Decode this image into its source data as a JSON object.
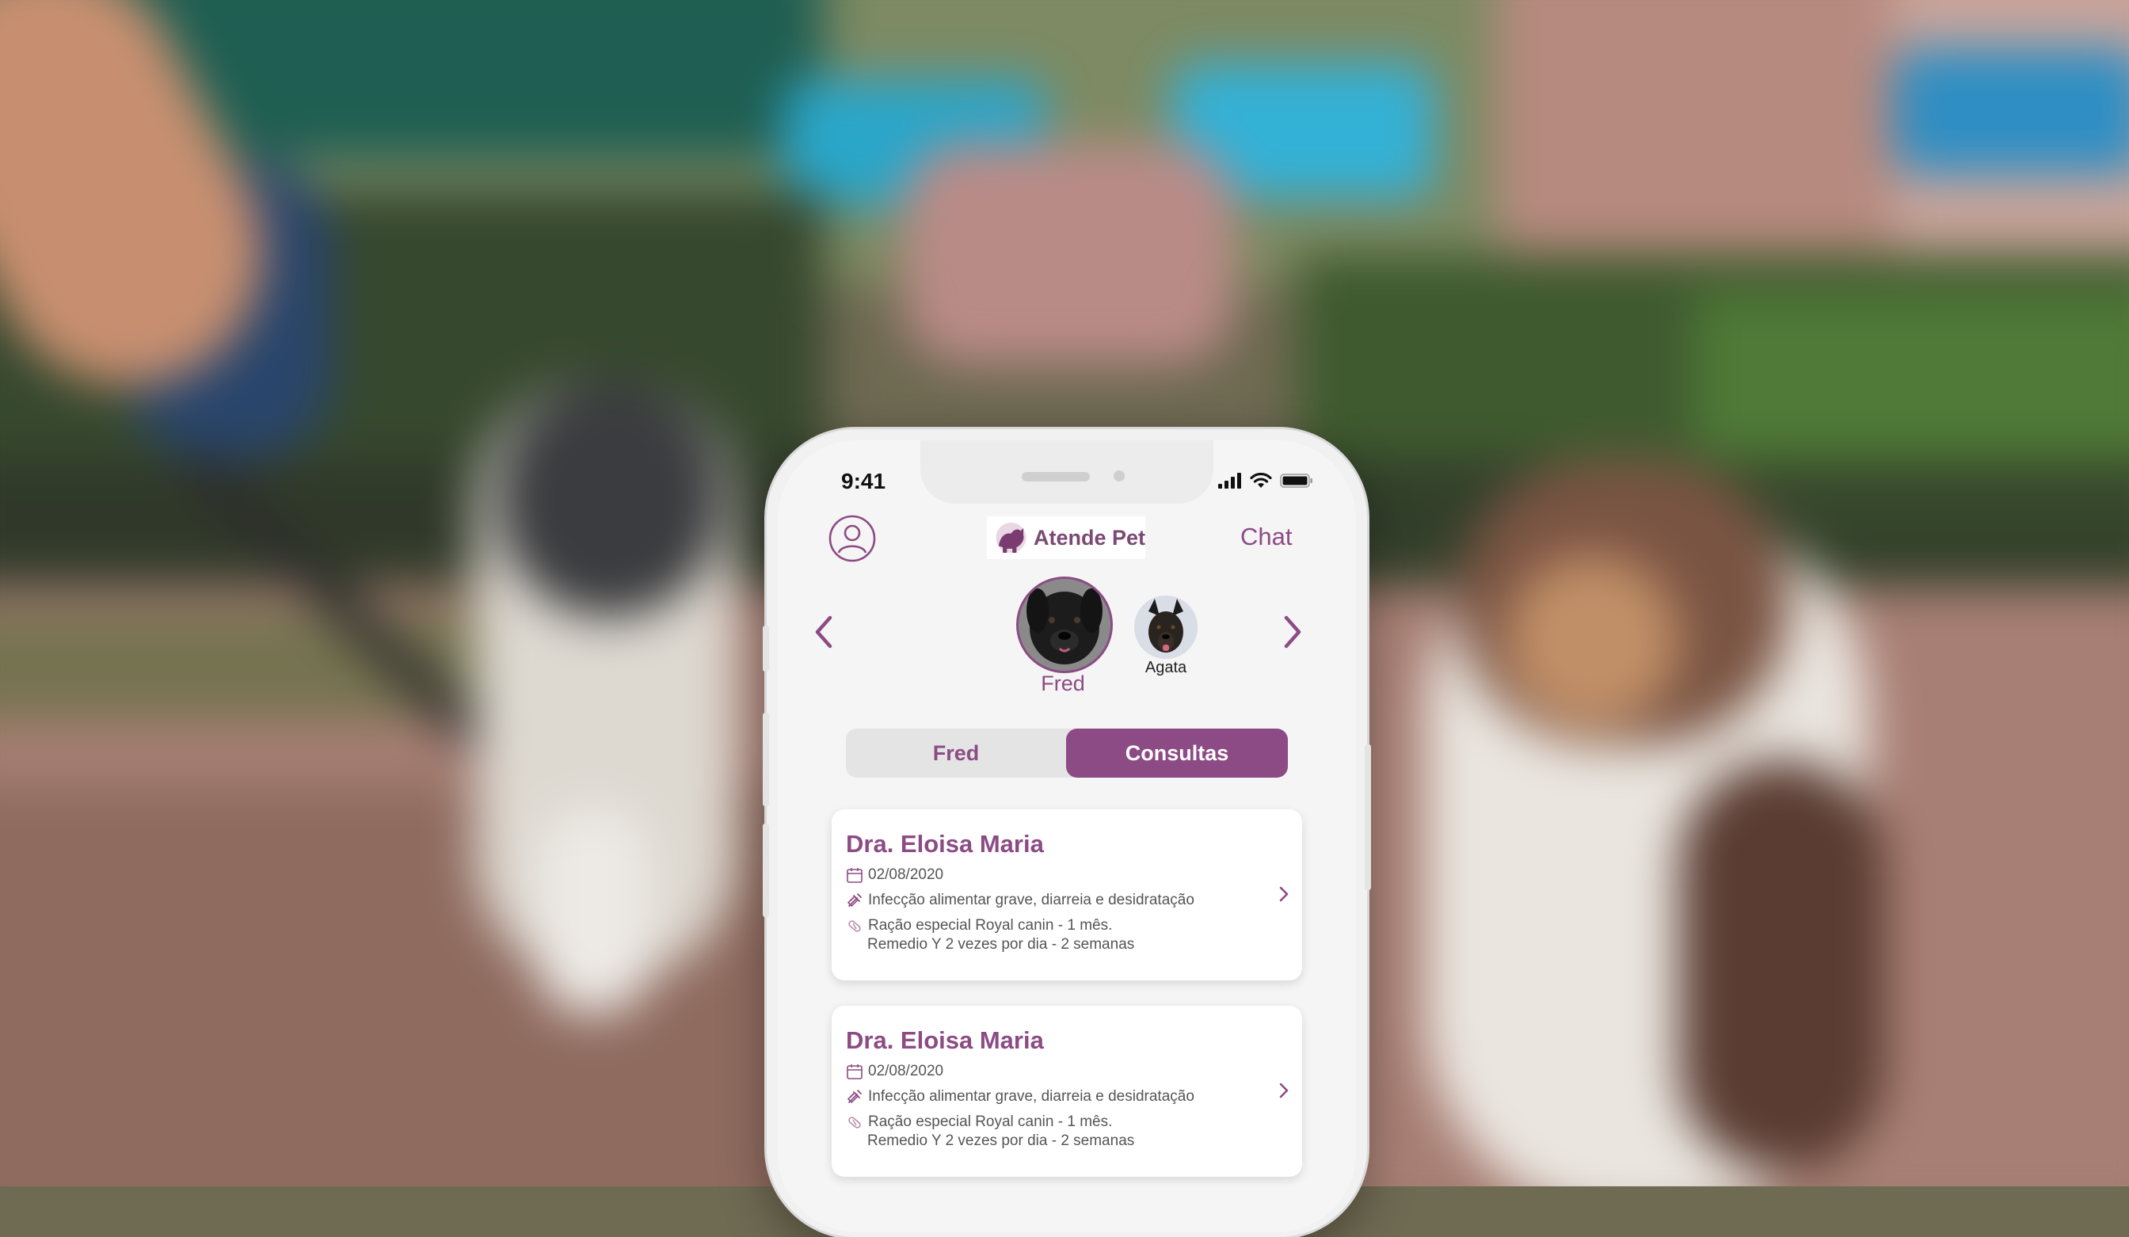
{
  "status_bar": {
    "time": "9:41"
  },
  "header": {
    "logo_text": "Atende Pet",
    "chat_label": "Chat",
    "profile_icon": "user-circle-icon"
  },
  "pets": {
    "selected": {
      "name": "Fred"
    },
    "next": {
      "name": "Agata"
    }
  },
  "tabs": [
    {
      "label": "Fred",
      "active": false
    },
    {
      "label": "Consultas",
      "active": true
    }
  ],
  "consultations": [
    {
      "vet": "Dra. Eloisa Maria",
      "date": "02/08/2020",
      "diagnosis": "Infecção alimentar grave, diarreia e desidratação",
      "treatment_line1": "Ração especial Royal canin - 1 mês.",
      "treatment_line2": "Remedio Y 2 vezes por dia - 2 semanas"
    },
    {
      "vet": "Dra. Eloisa Maria",
      "date": "02/08/2020",
      "diagnosis": "Infecção alimentar grave, diarreia e desidratação",
      "treatment_line1": "Ração especial Royal canin - 1 mês.",
      "treatment_line2": "Remedio Y 2 vezes por dia - 2 semanas"
    }
  ],
  "colors": {
    "accent": "#8c4b84",
    "tab_bg": "#e4e4e4",
    "screen_bg": "#f5f5f5"
  }
}
